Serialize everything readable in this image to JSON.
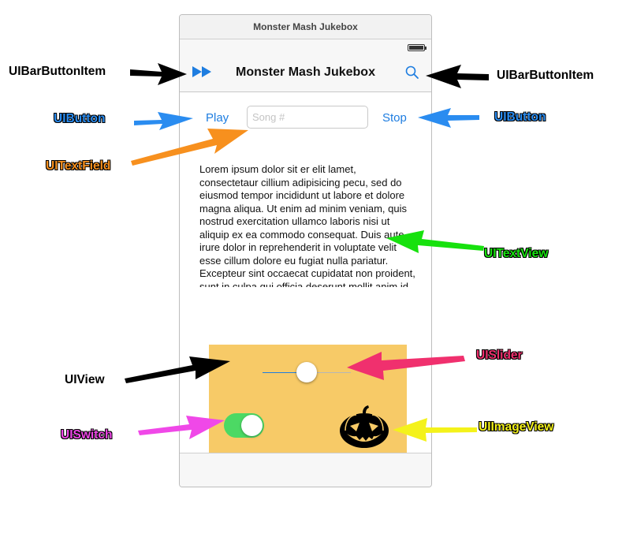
{
  "scene_title": "Monster Mash Jukebox",
  "navbar": {
    "title": "Monster Mash Jukebox",
    "left_icon": "fast-forward-icon",
    "right_icon": "search-icon"
  },
  "controls": {
    "play_label": "Play",
    "stop_label": "Stop",
    "song_placeholder": "Song #",
    "song_value": ""
  },
  "textview": {
    "text": "Lorem ipsum dolor sit er elit lamet, consectetaur cillium adipisicing pecu, sed do eiusmod tempor incididunt ut labore et dolore magna aliqua. Ut enim ad minim veniam, quis nostrud exercitation ullamco laboris nisi ut aliquip ex ea commodo consequat. Duis aute irure dolor in reprehenderit in voluptate velit esse cillum dolore eu fugiat nulla pariatur. Excepteur sint occaecat cupidatat non proident, sunt in culpa qui officia deserunt mollit anim id est laborum."
  },
  "slider": {
    "value": 0.5
  },
  "switch": {
    "on": true
  },
  "image_icon": "jack-o-lantern-icon",
  "colors": {
    "tint": "#1e7de0",
    "view_background": "#f7ca67",
    "switch_on": "#4cd964",
    "uibutton_label": "#2a8cf0",
    "uitextfield_label": "#f7901e",
    "uitextview_label": "#17e10e",
    "uislider_label": "#f0306e",
    "uiswitch_label": "#f048e8",
    "uiimageview_label": "#f4f21a",
    "uiview_label": "#000000",
    "uibarbuttonitem_label": "#000000"
  },
  "labels": {
    "bar_button_left": "UIBarButtonItem",
    "bar_button_right": "UIBarButtonItem",
    "button_left": "UIButton",
    "button_right": "UIButton",
    "text_field": "UITextField",
    "text_view": "UITextView",
    "view": "UIView",
    "slider": "UISlider",
    "switch": "UISwitch",
    "image_view": "UIImageView"
  }
}
